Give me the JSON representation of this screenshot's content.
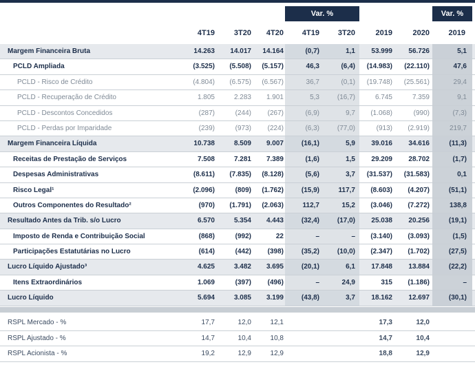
{
  "var_headers": {
    "quarter": "Var. %",
    "year": "Var. %"
  },
  "columns": [
    "4T19",
    "3T20",
    "4T20",
    "4T19",
    "3T20",
    "2019",
    "2020",
    "2019"
  ],
  "rows": [
    {
      "label": "Margem Financeira Bruta",
      "values": [
        "14.263",
        "14.017",
        "14.164",
        "(0,7)",
        "1,1",
        "53.999",
        "56.726",
        "5,1"
      ],
      "style": "total"
    },
    {
      "label": "PCLD Ampliada",
      "values": [
        "(3.525)",
        "(5.508)",
        "(5.157)",
        "46,3",
        "(6,4)",
        "(14.983)",
        "(22.110)",
        "47,6"
      ],
      "style": "bold"
    },
    {
      "label": "PCLD - Risco de Crédito",
      "values": [
        "(4.804)",
        "(6.575)",
        "(6.567)",
        "36,7",
        "(0,1)",
        "(19.748)",
        "(25.561)",
        "29,4"
      ],
      "style": "light"
    },
    {
      "label": "PCLD - Recuperação de Crédito",
      "values": [
        "1.805",
        "2.283",
        "1.901",
        "5,3",
        "(16,7)",
        "6.745",
        "7.359",
        "9,1"
      ],
      "style": "light"
    },
    {
      "label": "PCLD - Descontos Concedidos",
      "values": [
        "(287)",
        "(244)",
        "(267)",
        "(6,9)",
        "9,7",
        "(1.068)",
        "(990)",
        "(7,3)"
      ],
      "style": "light"
    },
    {
      "label": "PCLD - Perdas por Imparidade",
      "values": [
        "(239)",
        "(973)",
        "(224)",
        "(6,3)",
        "(77,0)",
        "(913)",
        "(2.919)",
        "219,7"
      ],
      "style": "light"
    },
    {
      "label": "Margem Financeira Líquida",
      "values": [
        "10.738",
        "8.509",
        "9.007",
        "(16,1)",
        "5,9",
        "39.016",
        "34.616",
        "(11,3)"
      ],
      "style": "total"
    },
    {
      "label": "Receitas de Prestação de Serviços",
      "values": [
        "7.508",
        "7.281",
        "7.389",
        "(1,6)",
        "1,5",
        "29.209",
        "28.702",
        "(1,7)"
      ],
      "style": "bold"
    },
    {
      "label": "Despesas Administrativas",
      "values": [
        "(8.611)",
        "(7.835)",
        "(8.128)",
        "(5,6)",
        "3,7",
        "(31.537)",
        "(31.583)",
        "0,1"
      ],
      "style": "bold"
    },
    {
      "label": "Risco Legal¹",
      "values": [
        "(2.096)",
        "(809)",
        "(1.762)",
        "(15,9)",
        "117,7",
        "(8.603)",
        "(4.207)",
        "(51,1)"
      ],
      "style": "bold"
    },
    {
      "label": "Outros Componentes do Resultado²",
      "values": [
        "(970)",
        "(1.791)",
        "(2.063)",
        "112,7",
        "15,2",
        "(3.046)",
        "(7.272)",
        "138,8"
      ],
      "style": "bold"
    },
    {
      "label": "Resultado Antes da Trib. s/o Lucro",
      "values": [
        "6.570",
        "5.354",
        "4.443",
        "(32,4)",
        "(17,0)",
        "25.038",
        "20.256",
        "(19,1)"
      ],
      "style": "total"
    },
    {
      "label": "Imposto de Renda e Contribuição Social",
      "values": [
        "(868)",
        "(992)",
        "22",
        "–",
        "–",
        "(3.140)",
        "(3.093)",
        "(1,5)"
      ],
      "style": "bold"
    },
    {
      "label": "Participações Estatutárias no Lucro",
      "values": [
        "(614)",
        "(442)",
        "(398)",
        "(35,2)",
        "(10,0)",
        "(2.347)",
        "(1.702)",
        "(27,5)"
      ],
      "style": "bold"
    },
    {
      "label": "Lucro Líquido Ajustado³",
      "values": [
        "4.625",
        "3.482",
        "3.695",
        "(20,1)",
        "6,1",
        "17.848",
        "13.884",
        "(22,2)"
      ],
      "style": "total"
    },
    {
      "label": "Itens Extraordinários",
      "values": [
        "1.069",
        "(397)",
        "(496)",
        "–",
        "24,9",
        "315",
        "(1.186)",
        "–"
      ],
      "style": "bold"
    },
    {
      "label": "Lucro Líquido",
      "values": [
        "5.694",
        "3.085",
        "3.199",
        "(43,8)",
        "3,7",
        "18.162",
        "12.697",
        "(30,1)"
      ],
      "style": "total"
    }
  ],
  "rspl_rows": [
    {
      "label": "RSPL Mercado - %",
      "values": [
        "17,7",
        "12,0",
        "12,1",
        "17,3",
        "12,0"
      ]
    },
    {
      "label": "RSPL Ajustado - %",
      "values": [
        "14,7",
        "10,4",
        "10,8",
        "14,7",
        "10,4"
      ]
    },
    {
      "label": "RSPL Acionista - %",
      "values": [
        "19,2",
        "12,9",
        "12,9",
        "18,8",
        "12,9"
      ]
    }
  ]
}
